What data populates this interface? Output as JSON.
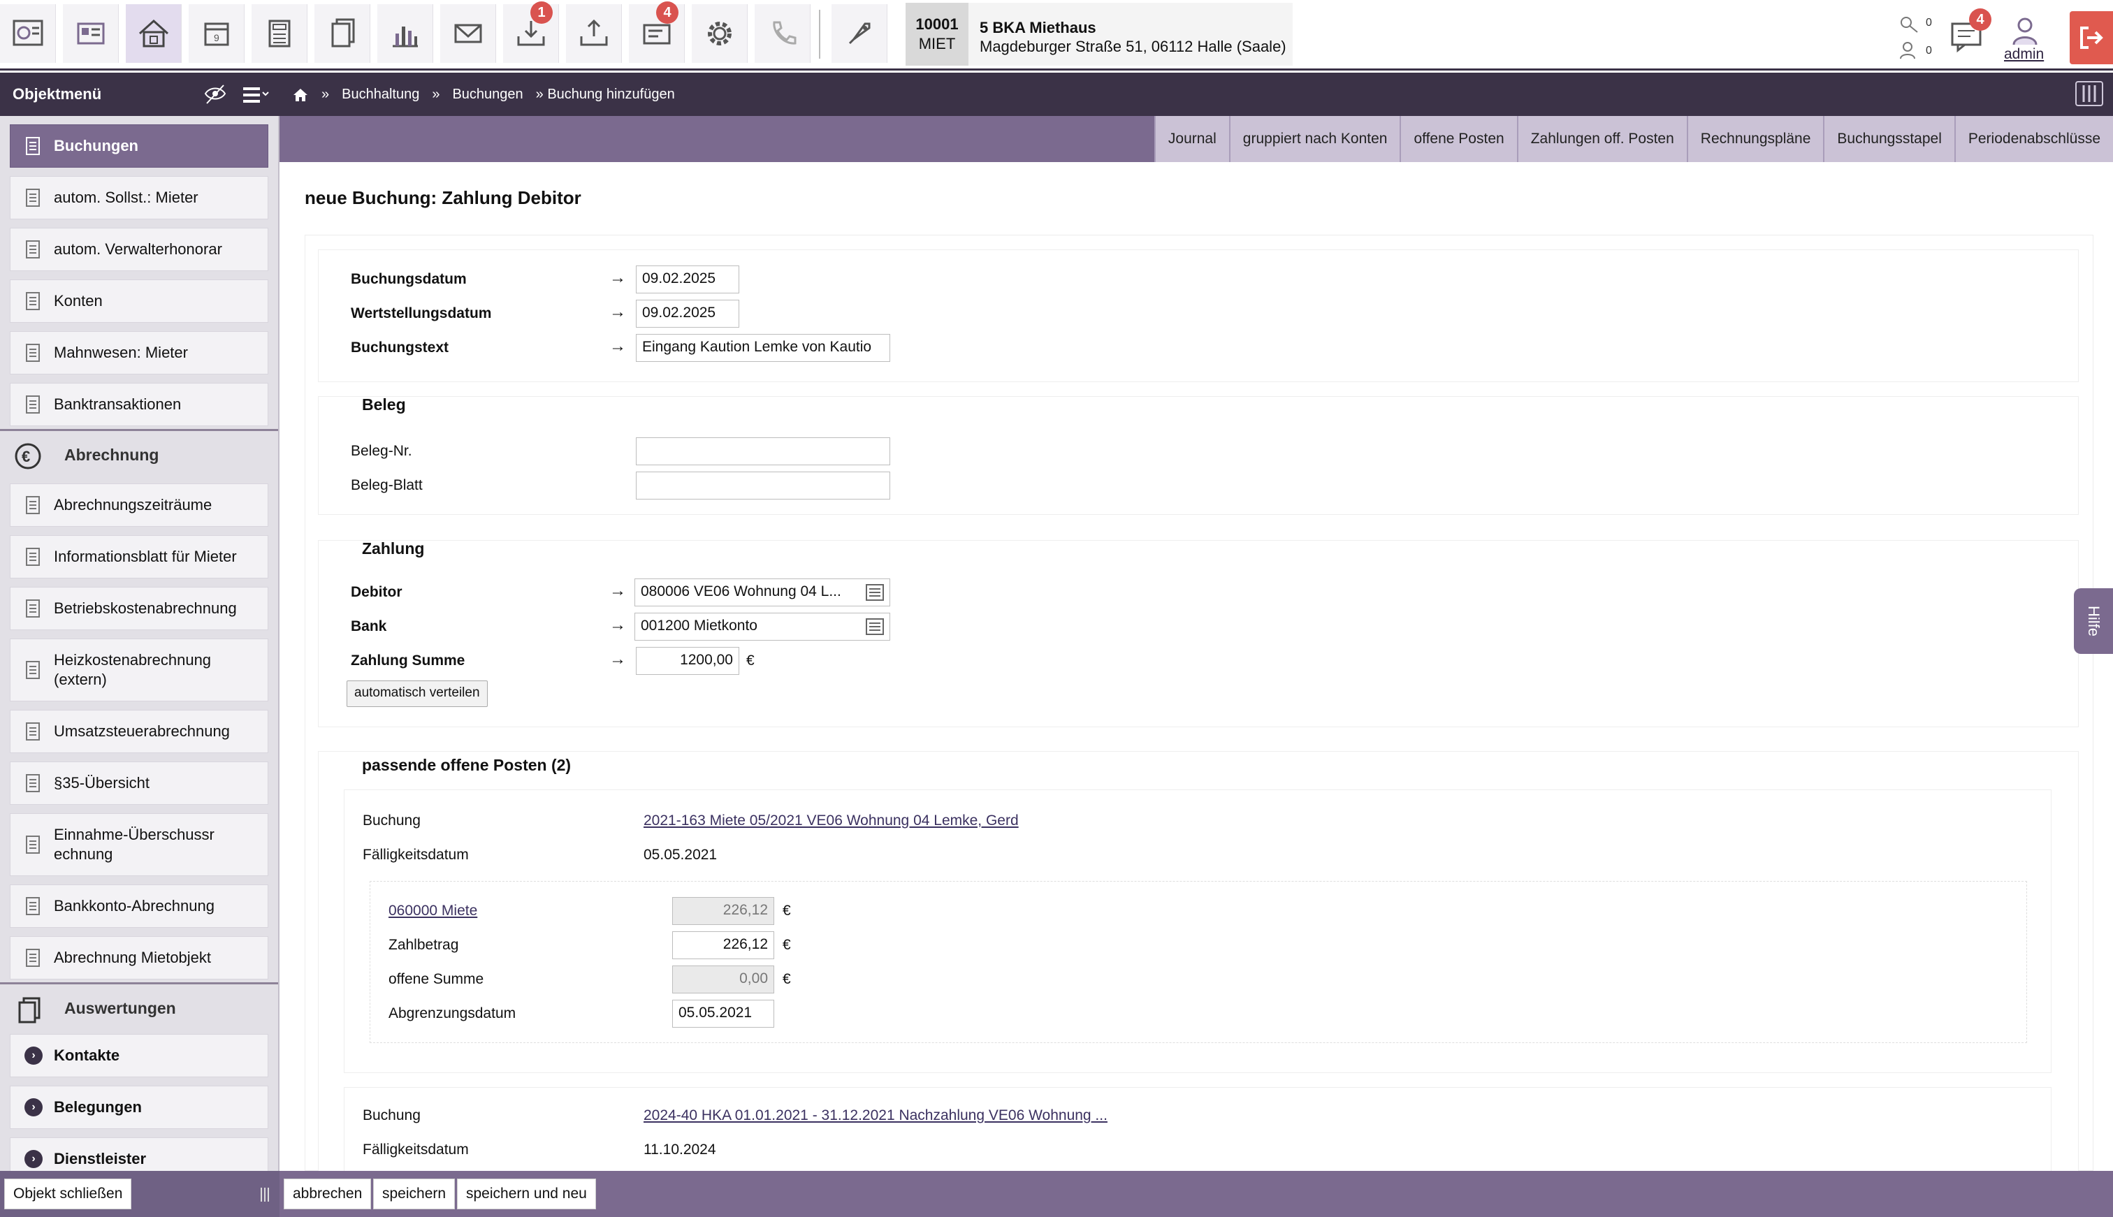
{
  "topbar": {
    "badges": {
      "download": "1",
      "inbox": "4"
    },
    "object_code": "10001",
    "object_type": "MIET",
    "object_name": "5 BKA Miethaus",
    "object_address": "Magdeburger Straße 51, 06112 Halle (Saale)",
    "mini_count_1": "0",
    "mini_count_2": "0",
    "messages_badge": "4",
    "user": "admin",
    "icons": [
      "dashboard-icon",
      "cards-icon",
      "house-icon",
      "calendar-icon",
      "calculator-icon",
      "documents-icon",
      "chart-icon",
      "mail-icon",
      "download-icon",
      "upload-icon",
      "ticket-icon",
      "gear-icon",
      "phone-icon",
      "rocket-icon"
    ]
  },
  "nav": {
    "menu_title": "Objektmenü",
    "breadcrumb": {
      "sep1": "»",
      "item1": "Buchhaltung",
      "sep2": "»",
      "item2": "Buchungen",
      "item3": "» Buchung hinzufügen"
    }
  },
  "sidebar": {
    "items": [
      "Buchungen",
      "autom. Sollst.: Mieter",
      "autom. Verwalterhonorar",
      "Konten",
      "Mahnwesen: Mieter",
      "Banktransaktionen"
    ],
    "section_abrechnung": "Abrechnung",
    "abrechnung_items": [
      "Abrechnungszeiträume",
      "Informationsblatt für Mieter",
      "Betriebskostenabrechnung",
      "Heizkostenabrechnung (extern)",
      "Umsatzsteuerabrechnung",
      "§35-Übersicht",
      "Einnahme-Überschussrechnung",
      "Bankkonto-Abrechnung",
      "Abrechnung Mietobjekt"
    ],
    "section_auswertungen": "Auswertungen",
    "groups": [
      "Kontakte",
      "Belegungen",
      "Dienstleister"
    ]
  },
  "tabs": [
    "Journal",
    "gruppiert nach Konten",
    "offene Posten",
    "Zahlungen off. Posten",
    "Rechnungspläne",
    "Buchungsstapel",
    "Periodenabschlüsse"
  ],
  "form": {
    "title": "neue Buchung: Zahlung Debitor",
    "buchungsdatum_label": "Buchungsdatum",
    "buchungsdatum": "09.02.2025",
    "wertstellungsdatum_label": "Wertstellungsdatum",
    "wertstellungsdatum": "09.02.2025",
    "buchungstext_label": "Buchungstext",
    "buchungstext": "Eingang Kaution  Lemke von Kautio",
    "beleg_title": "Beleg",
    "beleg_nr_label": "Beleg-Nr.",
    "beleg_nr": "",
    "beleg_blatt_label": "Beleg-Blatt",
    "beleg_blatt": "",
    "zahlung_title": "Zahlung",
    "debitor_label": "Debitor",
    "debitor": "080006 VE06 Wohnung 04 L...",
    "bank_label": "Bank",
    "bank": "001200 Mietkonto",
    "summe_label": "Zahlung Summe",
    "summe": "1200,00",
    "currency": "€",
    "auto_button": "automatisch verteilen"
  },
  "open_items": {
    "title": "passende offene Posten (2)",
    "buchung_label": "Buchung",
    "faellig_label": "Fälligkeitsdatum",
    "item1": {
      "buchung": "2021-163 Miete 05/2021 VE06 Wohnung 04 Lemke, Gerd",
      "faellig": "05.05.2021",
      "konto": "060000 Miete",
      "konto_value": "226,12",
      "zahlbetrag_label": "Zahlbetrag",
      "zahlbetrag": "226,12",
      "offen_label": "offene Summe",
      "offen": "0,00",
      "abgrenzung_label": "Abgrenzungsdatum",
      "abgrenzung": "05.05.2021"
    },
    "item2": {
      "buchung": "2024-40 HKA 01.01.2021 - 31.12.2021 Nachzahlung VE06 Wohnung ...",
      "faellig": "11.10.2024"
    }
  },
  "bottom": {
    "close": "Objekt schließen",
    "cancel": "abbrechen",
    "save": "speichern",
    "save_new": "speichern und neu"
  },
  "help": "Hilfe"
}
